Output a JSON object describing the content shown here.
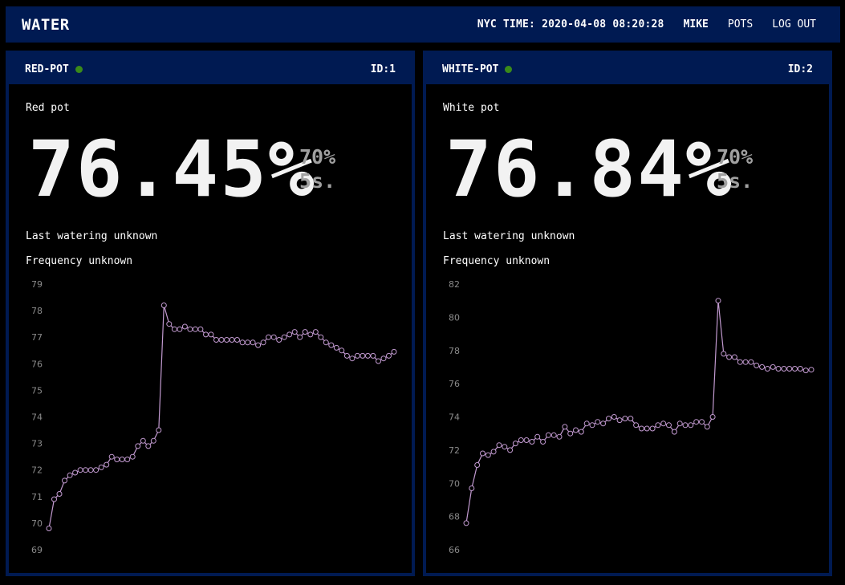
{
  "app": {
    "title": "WATER"
  },
  "nav": {
    "clock": "NYC TIME: 2020-04-08 08:20:28",
    "user": "MIKE",
    "pots": "POTS",
    "logout": "LOG OUT"
  },
  "colors": {
    "accent": "#001a52",
    "status_ok": "#3a8a1a",
    "series": "#c29ad0"
  },
  "pots": [
    {
      "name": "RED-POT",
      "id_label": "ID:1",
      "description": "Red pot",
      "reading": "76.45%",
      "threshold": "70%",
      "interval": "5s.",
      "last_watering": "Last watering unknown",
      "frequency": "Frequency unknown"
    },
    {
      "name": "WHITE-POT",
      "id_label": "ID:2",
      "description": "White pot",
      "reading": "76.84%",
      "threshold": "70%",
      "interval": "5s.",
      "last_watering": "Last watering unknown",
      "frequency": "Frequency unknown"
    }
  ],
  "chart_data": [
    {
      "type": "line",
      "title": "",
      "xlabel": "",
      "ylabel": "",
      "ylim": [
        69,
        79
      ],
      "yticks": [
        79,
        78,
        77,
        76,
        75,
        74,
        73,
        72,
        71,
        70,
        69
      ],
      "series": [
        {
          "values": [
            69.8,
            70.9,
            71.1,
            71.6,
            71.8,
            71.9,
            72.0,
            72.0,
            72.0,
            72.0,
            72.1,
            72.2,
            72.5,
            72.4,
            72.4,
            72.4,
            72.5,
            72.9,
            73.1,
            72.9,
            73.1,
            73.5,
            78.2,
            77.5,
            77.3,
            77.3,
            77.4,
            77.3,
            77.3,
            77.3,
            77.1,
            77.1,
            76.9,
            76.9,
            76.9,
            76.9,
            76.9,
            76.8,
            76.8,
            76.8,
            76.7,
            76.8,
            77.0,
            77.0,
            76.9,
            77.0,
            77.1,
            77.2,
            77.0,
            77.2,
            77.1,
            77.2,
            77.0,
            76.8,
            76.7,
            76.6,
            76.5,
            76.3,
            76.2,
            76.3,
            76.3,
            76.3,
            76.3,
            76.1,
            76.2,
            76.3,
            76.45
          ]
        }
      ]
    },
    {
      "type": "line",
      "title": "",
      "xlabel": "",
      "ylabel": "",
      "ylim": [
        66,
        82
      ],
      "yticks": [
        82,
        80,
        78,
        76,
        74,
        72,
        70,
        68,
        66
      ],
      "series": [
        {
          "values": [
            67.6,
            69.7,
            71.1,
            71.8,
            71.7,
            71.9,
            72.3,
            72.2,
            72.0,
            72.4,
            72.6,
            72.6,
            72.5,
            72.8,
            72.5,
            72.9,
            72.9,
            72.8,
            73.4,
            73.0,
            73.2,
            73.1,
            73.6,
            73.5,
            73.7,
            73.6,
            73.9,
            74.0,
            73.8,
            73.9,
            73.9,
            73.5,
            73.3,
            73.3,
            73.3,
            73.5,
            73.6,
            73.5,
            73.1,
            73.6,
            73.5,
            73.5,
            73.7,
            73.7,
            73.4,
            74.0,
            81.0,
            77.8,
            77.6,
            77.6,
            77.3,
            77.3,
            77.3,
            77.1,
            77.0,
            76.9,
            77.0,
            76.9,
            76.9,
            76.9,
            76.9,
            76.9,
            76.8,
            76.84
          ]
        }
      ]
    }
  ]
}
